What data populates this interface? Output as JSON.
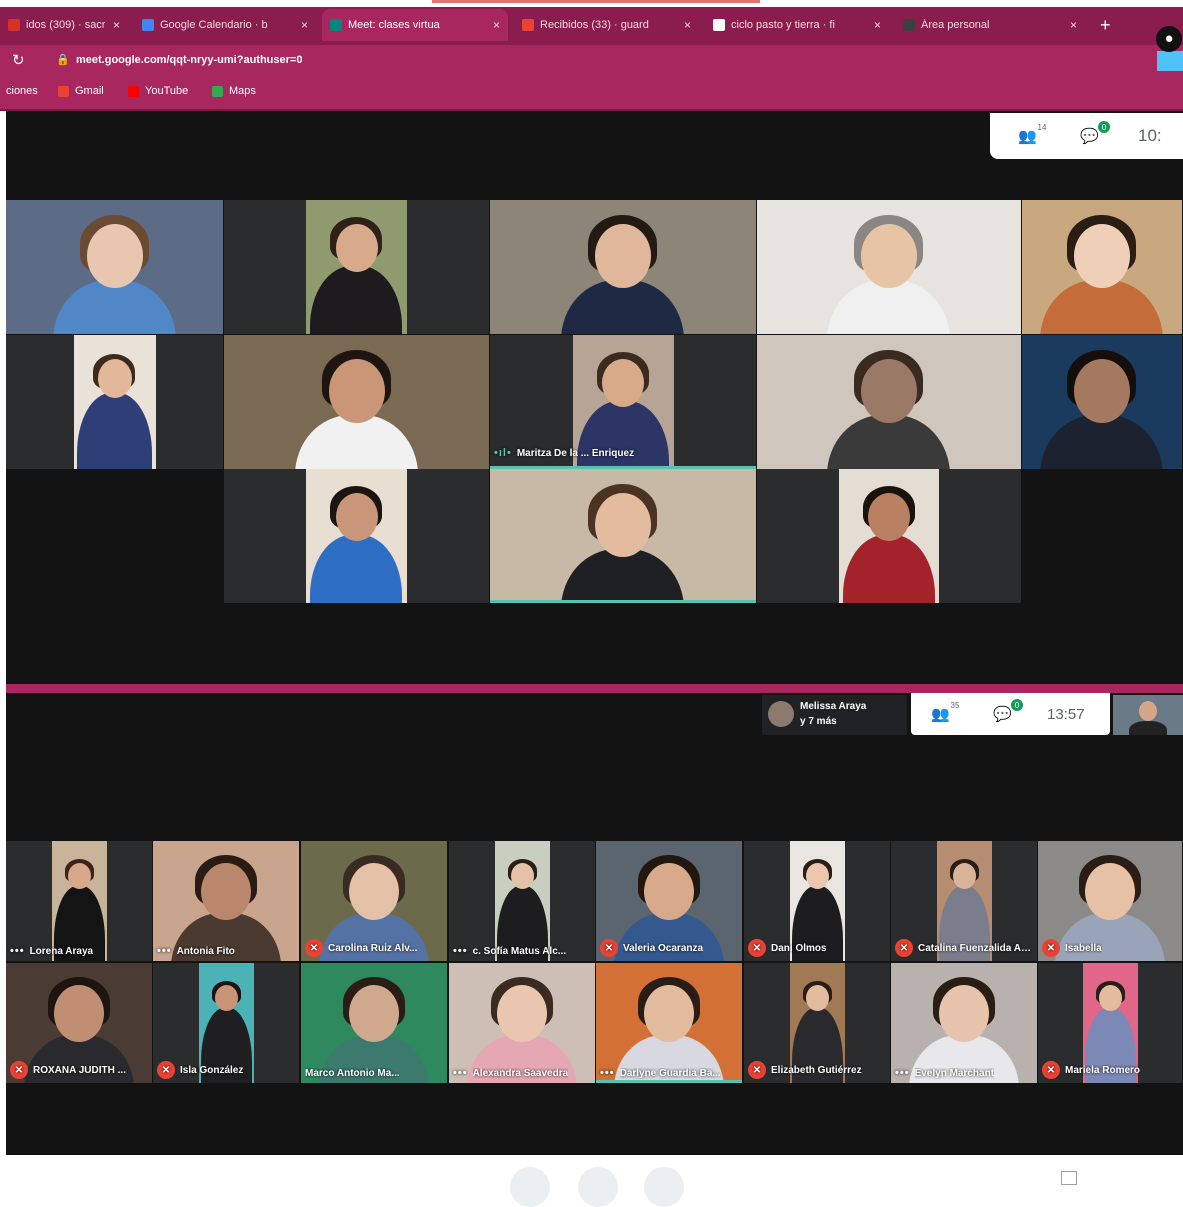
{
  "browser": {
    "tabs": [
      {
        "label": "idos (309) · sacr",
        "fav": "#d93025"
      },
      {
        "label": "Google Calendario · b",
        "fav": "#4285f4"
      },
      {
        "label": "Meet: clases virtua",
        "fav": "#00897b",
        "active": true
      },
      {
        "label": "Recibidos (33) · guard",
        "fav": "#ea4335"
      },
      {
        "label": "ciclo pasto y tierra · fi",
        "fav": "#ffffff"
      },
      {
        "label": "Área personal",
        "fav": "#3c4043"
      }
    ],
    "new_tab_icon": "plus-icon",
    "url": "meet.google.com/qqt-nryy-umi?authuser=0",
    "bookmarks": [
      {
        "label": "ciones",
        "icon": "apps-icon",
        "color": "#ffffff"
      },
      {
        "label": "Gmail",
        "icon": "gmail-icon",
        "color": "#ea4335"
      },
      {
        "label": "YouTube",
        "icon": "youtube-icon",
        "color": "#ff0000"
      },
      {
        "label": "Maps",
        "icon": "maps-icon",
        "color": "#34a853"
      }
    ]
  },
  "meet_top": {
    "panel": {
      "people_count": "14",
      "chat_badge": "0",
      "time": "10:"
    },
    "tiles": [
      {
        "row": 0,
        "col": 0,
        "bg": "#5c6b86",
        "skin": "#e9c6b0",
        "hair": "#6b4a32",
        "shirt": "#4f87c7"
      },
      {
        "row": 0,
        "col": 1,
        "bg": "#2b2c2e",
        "skin": "#d8a98a",
        "hair": "#2d2118",
        "shirt": "#1d1b1e",
        "frame": "#8f9b6f",
        "narrow": true
      },
      {
        "row": 0,
        "col": 2,
        "bg": "#8d8578",
        "skin": "#e0b79a",
        "hair": "#231a14",
        "shirt": "#1e2a44"
      },
      {
        "row": 0,
        "col": 3,
        "bg": "#e7e4df",
        "skin": "#e8c4a7",
        "hair": "#8a8684",
        "shirt": "#f0f0f0"
      },
      {
        "row": 0,
        "col": 4,
        "bg": "#c9a77f",
        "skin": "#efcfb8",
        "hair": "#2a1d14",
        "shirt": "#c46d3a"
      },
      {
        "row": 1,
        "col": 0,
        "bg": "#2b2c2e",
        "skin": "#e3b79a",
        "hair": "#3d2a1c",
        "shirt": "#2e3f78",
        "frame": "#e9e2d8",
        "narrow": true
      },
      {
        "row": 1,
        "col": 1,
        "bg": "#7a6a54",
        "skin": "#c99678",
        "hair": "#1e1510",
        "shirt": "#f1f1f1"
      },
      {
        "row": 1,
        "col": 2,
        "bg": "#2b2c2e",
        "skin": "#d9aa8a",
        "hair": "#3a2a1f",
        "shirt": "#2c3566",
        "frame": "#b6a594",
        "narrow": true,
        "name": "Maritza De la ... Enriquez",
        "speaking": true
      },
      {
        "row": 1,
        "col": 3,
        "bg": "#cfc6bd",
        "skin": "#9a7a66",
        "hair": "#3a2b22",
        "shirt": "#3b3a3a"
      },
      {
        "row": 1,
        "col": 4,
        "bg": "#1a3a5e",
        "skin": "#a57860",
        "hair": "#140f0c",
        "shirt": "#1d2230"
      },
      {
        "row": 2,
        "col": 1,
        "bg": "#2b2c2e",
        "skin": "#c9967a",
        "hair": "#1b1410",
        "shirt": "#2f6ec5",
        "frame": "#e8ded2",
        "narrow": true
      },
      {
        "row": 2,
        "col": 2,
        "bg": "#c8b8a6",
        "skin": "#e3bca0",
        "hair": "#4a3323",
        "shirt": "#1f2024",
        "speaking": true
      },
      {
        "row": 2,
        "col": 3,
        "bg": "#2b2c2e",
        "skin": "#b98062",
        "hair": "#1a120d",
        "shirt": "#a4232a",
        "frame": "#e3ddd4",
        "narrow": true
      }
    ]
  },
  "meet_bottom": {
    "pinned_label": {
      "line1": "Melissa Araya",
      "line2": "y 7 más"
    },
    "panel": {
      "people_count": "35",
      "chat_badge": "0",
      "time": "13:57"
    },
    "row1": [
      {
        "name": "Lorena Araya",
        "state": "dots",
        "bg": "#2b2c2e",
        "skin": "#d7a88a",
        "hair": "#3a2318",
        "shirt": "#141414",
        "frame": "#c8b49a",
        "narrow": true
      },
      {
        "name": "Antonia Fito",
        "state": "dots",
        "bg": "#c9a58e",
        "skin": "#b8876c",
        "hair": "#2a1c13",
        "shirt": "#4a3a30"
      },
      {
        "name": "Carolina Ruiz Alv...",
        "state": "mute",
        "bg": "#6b6a4b",
        "skin": "#e3c0a6",
        "hair": "#3a2b22",
        "shirt": "#5572a5"
      },
      {
        "name": "c. Sofía Matus Alc...",
        "state": "dots",
        "bg": "#2b2c2e",
        "skin": "#e3c2a8",
        "hair": "#2b1e16",
        "shirt": "#1d1d1f",
        "frame": "#c9cfc0",
        "narrow": true
      },
      {
        "name": "Valeria Ocaranza",
        "state": "mute",
        "bg": "#5b6570",
        "skin": "#d9a98c",
        "hair": "#21170f",
        "shirt": "#34598f"
      },
      {
        "name": "Dani Olmos",
        "state": "mute",
        "bg": "#2b2c2e",
        "skin": "#ecc7ad",
        "hair": "#2a1d15",
        "shirt": "#1d1d20",
        "frame": "#e9e6e1",
        "narrow": true
      },
      {
        "name": "Catalina Fuenzalida Azola",
        "state": "mute",
        "bg": "#2b2c2e",
        "skin": "#d9b39a",
        "hair": "#2a1d15",
        "shirt": "#7a7e8c",
        "frame": "#b78d71",
        "narrow": true
      },
      {
        "name": "Isabella",
        "state": "mute",
        "bg": "#8c8a88",
        "skin": "#e6c1a6",
        "hair": "#2a1d15",
        "shirt": "#9aa4b8"
      }
    ],
    "row2": [
      {
        "name": "ROXANA JUDITH ...",
        "state": "mute",
        "bg": "#4a3b34",
        "skin": "#c08f73",
        "hair": "#1e1510",
        "shirt": "#2a2a2e"
      },
      {
        "name": "Isla González",
        "state": "mute",
        "bg": "#2b2c2e",
        "skin": "#c99377",
        "hair": "#1b1410",
        "shirt": "#1f1f22",
        "frame": "#4bb3b5",
        "narrow": true
      },
      {
        "name": "Marco Antonio Ma...",
        "state": "none",
        "bg": "#2e8a5e",
        "skin": "#cfa88e",
        "hair": "#2a1d15",
        "shirt": "#3d7a6e"
      },
      {
        "name": "Alexandra Saavedra",
        "state": "dots",
        "bg": "#cdbfb6",
        "skin": "#e9c6ad",
        "hair": "#3a2b22",
        "shirt": "#e5a8b3"
      },
      {
        "name": "Darlyne Guardia Ba...",
        "state": "dots",
        "bg": "#d27036",
        "skin": "#e3bca0",
        "hair": "#2a1d15",
        "shirt": "#d8d8e0",
        "speaking": true
      },
      {
        "name": "Elizabeth Gutiérrez",
        "state": "mute",
        "bg": "#2b2c2e",
        "skin": "#e3bca0",
        "hair": "#2a1d15",
        "shirt": "#2a2a2e",
        "frame": "#a07a55",
        "narrow": true
      },
      {
        "name": "Evelyn Marchant",
        "state": "dots",
        "bg": "#b8b1ad",
        "skin": "#e6c3aa",
        "hair": "#2a1d15",
        "shirt": "#e8e8ec"
      },
      {
        "name": "Mariela Romero",
        "state": "mute",
        "bg": "#2b2c2e",
        "skin": "#e3bca0",
        "hair": "#2a1d15",
        "shirt": "#7c88b6",
        "frame": "#e0668a",
        "narrow": true
      }
    ]
  },
  "colors": {
    "chrome": "#a8275f",
    "tabstrip": "#8a1c4e",
    "meet_bg": "#131314",
    "speaking": "#56c3b0",
    "mute": "#ea4335"
  }
}
